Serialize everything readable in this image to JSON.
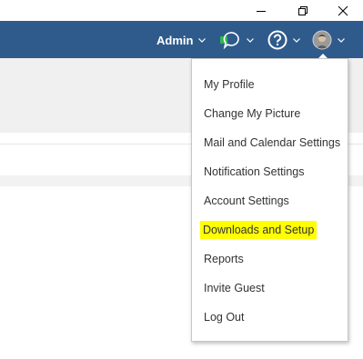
{
  "header": {
    "admin_label": "Admin"
  },
  "menu": {
    "items": [
      {
        "label": "My Profile"
      },
      {
        "label": "Change My Picture"
      },
      {
        "label": "Mail and Calendar Settings"
      },
      {
        "label": "Notification Settings"
      },
      {
        "label": "Account Settings"
      },
      {
        "label": "Downloads and Setup",
        "highlighted": true
      },
      {
        "label": "Reports"
      },
      {
        "label": "Invite Guest"
      },
      {
        "label": "Log Out"
      }
    ]
  },
  "colors": {
    "header_bg": "#2f5b8c",
    "highlight": "#ffff00",
    "skype_green": "#2db84d"
  },
  "icons": [
    "minimize-icon",
    "restore-icon",
    "close-icon",
    "skype-status-icon",
    "help-icon",
    "avatar",
    "chevron-down-icon"
  ]
}
